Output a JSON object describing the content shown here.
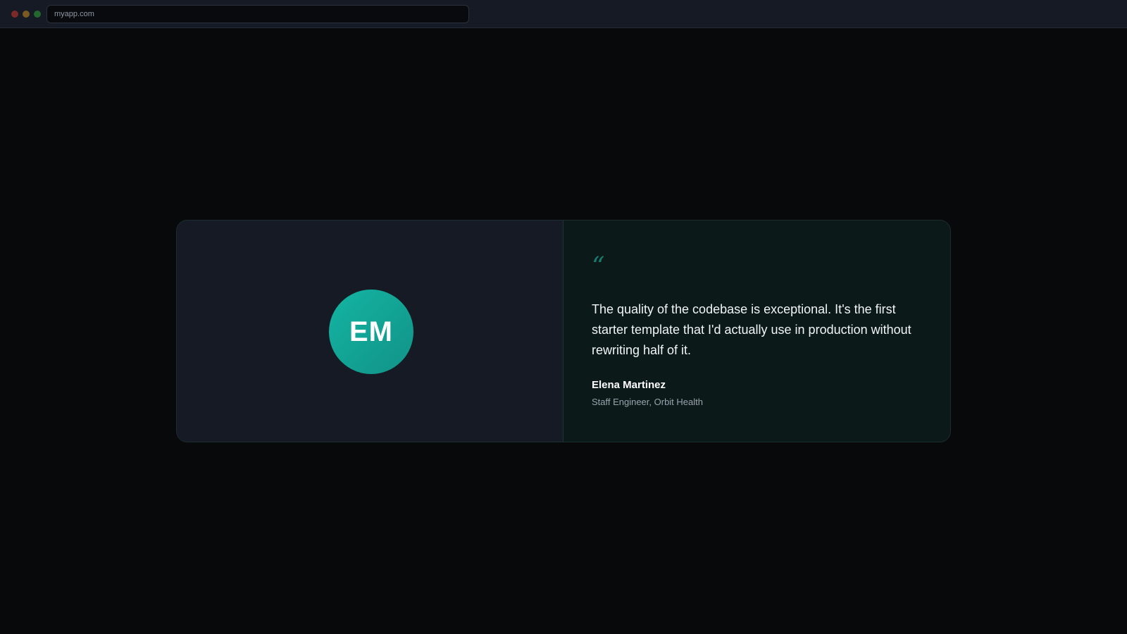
{
  "browser": {
    "url": "myapp.com",
    "traffic_lights": {
      "red": "#7b2a27",
      "yellow": "#7a5a22",
      "green": "#23662f"
    }
  },
  "testimonial": {
    "avatar_initials": "EM",
    "quote_mark": "“",
    "quote": "The quality of the codebase is exceptional. It's the first starter template that I'd actually use in production without rewriting half of it.",
    "author_name": "Elena Martinez",
    "author_title": "Staff Engineer, Orbit Health",
    "accent_color": "#14b5a3"
  }
}
